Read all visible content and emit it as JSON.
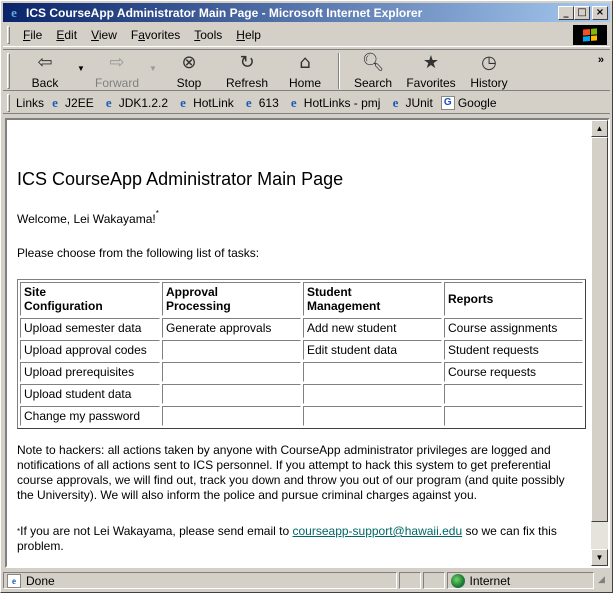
{
  "window": {
    "title": "ICS CourseApp Administrator Main Page - Microsoft Internet Explorer",
    "controls": [
      "_",
      "□",
      "×"
    ]
  },
  "menu": {
    "items": [
      {
        "label": "File",
        "key": "F",
        "rest": "ile"
      },
      {
        "label": "Edit",
        "key": "E",
        "rest": "dit"
      },
      {
        "label": "View",
        "key": "V",
        "rest": "iew"
      },
      {
        "label": "Favorites",
        "key": "a",
        "pre": "F",
        "rest": "vorites"
      },
      {
        "label": "Tools",
        "key": "T",
        "rest": "ools"
      },
      {
        "label": "Help",
        "key": "H",
        "rest": "elp"
      }
    ]
  },
  "toolbar": {
    "back": "Back",
    "forward": "Forward",
    "stop": "Stop",
    "refresh": "Refresh",
    "home": "Home",
    "search": "Search",
    "favorites": "Favorites",
    "history": "History",
    "overflow": "»"
  },
  "links": {
    "label": "Links",
    "items": [
      "J2EE",
      "JDK1.2.2",
      "HotLink",
      "613",
      "HotLinks - pmj",
      "JUnit",
      "Google"
    ]
  },
  "page": {
    "heading": "ICS CourseApp Administrator Main Page",
    "welcome": "Welcome, Lei Wakayama!",
    "welcome_mark": "*",
    "prompt": "Please choose from the following list of tasks:",
    "table": {
      "headers": [
        [
          "Site",
          "Configuration"
        ],
        [
          "Approval",
          "Processing"
        ],
        [
          "Student",
          "Management"
        ],
        [
          "Reports",
          ""
        ]
      ],
      "rows": [
        [
          "Upload semester data",
          "Generate approvals",
          "Add new student",
          "Course assignments"
        ],
        [
          "Upload approval codes",
          "",
          "Edit student data",
          "Student requests"
        ],
        [
          "Upload prerequisites",
          "",
          "",
          "Course requests"
        ],
        [
          "Upload student data",
          "",
          "",
          ""
        ],
        [
          "Change my password",
          "",
          "",
          ""
        ]
      ]
    },
    "note": "Note to hackers: all actions taken by anyone with CourseApp administrator privileges are logged and notifications of all actions sent to ICS personnel. If you attempt to hack this system to get preferential course approvals, we will find out, track you down and throw you out of our program (and quite possibly the University). We will also inform the police and pursue criminal charges against you.",
    "footnote_mark": "*",
    "footnote_before": "If you are not Lei Wakayama, please send email to ",
    "footnote_link": "courseapp-support@hawaii.edu",
    "footnote_after": " so we can fix this problem."
  },
  "status": {
    "text": "Done",
    "zone": "Internet"
  },
  "colors": {
    "titlebar_start": "#0a246a",
    "titlebar_end": "#a6caf0",
    "link": "#006666",
    "chrome": "#d4d0c8"
  }
}
